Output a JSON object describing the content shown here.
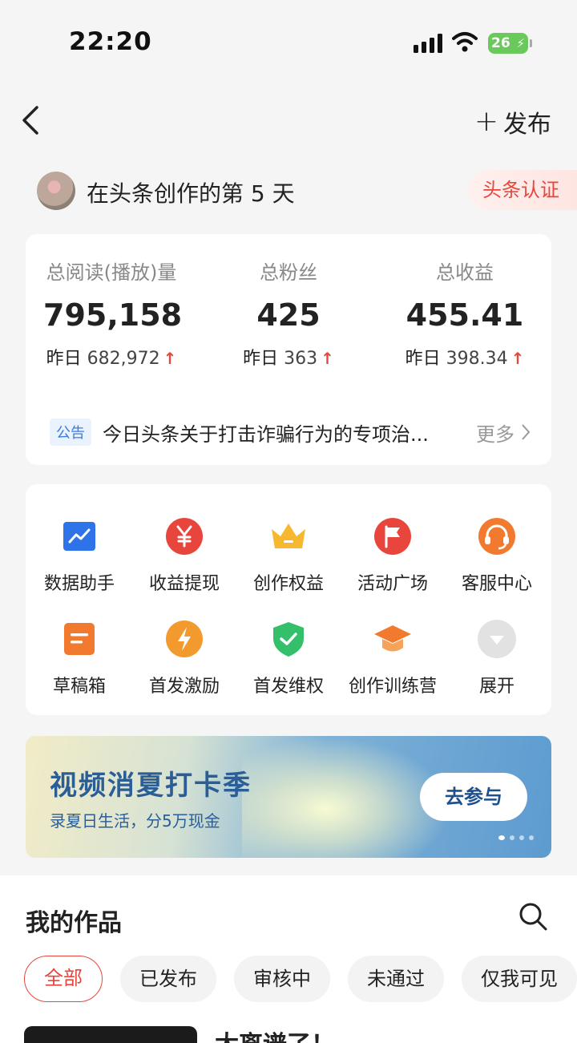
{
  "status_bar": {
    "time": "22:20",
    "battery": "26"
  },
  "nav": {
    "publish_label": "发布"
  },
  "creator": {
    "days_text": "在头条创作的第 5 天",
    "verify_label": "头条认证"
  },
  "stats": [
    {
      "label": "总阅读(播放)量",
      "value": "795,158",
      "yday_prefix": "昨日",
      "yday_value": "682,972"
    },
    {
      "label": "总粉丝",
      "value": "425",
      "yday_prefix": "昨日",
      "yday_value": "363"
    },
    {
      "label": "总收益",
      "value": "455.41",
      "yday_prefix": "昨日",
      "yday_value": "398.34"
    }
  ],
  "notice": {
    "tag": "公告",
    "text": "今日头条关于打击诈骗行为的专项治...",
    "more": "更多"
  },
  "tools": [
    {
      "label": "数据助手",
      "icon": "chart-icon"
    },
    {
      "label": "收益提现",
      "icon": "yuan-icon"
    },
    {
      "label": "创作权益",
      "icon": "crown-icon"
    },
    {
      "label": "活动广场",
      "icon": "flag-icon"
    },
    {
      "label": "客服中心",
      "icon": "headset-icon"
    },
    {
      "label": "草稿箱",
      "icon": "draft-icon"
    },
    {
      "label": "首发激励",
      "icon": "lightning-icon"
    },
    {
      "label": "首发维权",
      "icon": "shield-check-icon"
    },
    {
      "label": "创作训练营",
      "icon": "graduation-cap-icon"
    },
    {
      "label": "展开",
      "icon": "expand-icon"
    }
  ],
  "banner": {
    "title": "视频消夏打卡季",
    "subtitle": "录夏日生活，分5万现金",
    "cta": "去参与"
  },
  "works": {
    "title": "我的作品",
    "tabs": [
      "全部",
      "已发布",
      "审核中",
      "未通过",
      "仅我可见"
    ],
    "first_item_title": "太离谱了！"
  },
  "colors": {
    "accent": "#e8463c",
    "link_blue": "#3a7be0",
    "banner_text": "#2b5d96"
  }
}
